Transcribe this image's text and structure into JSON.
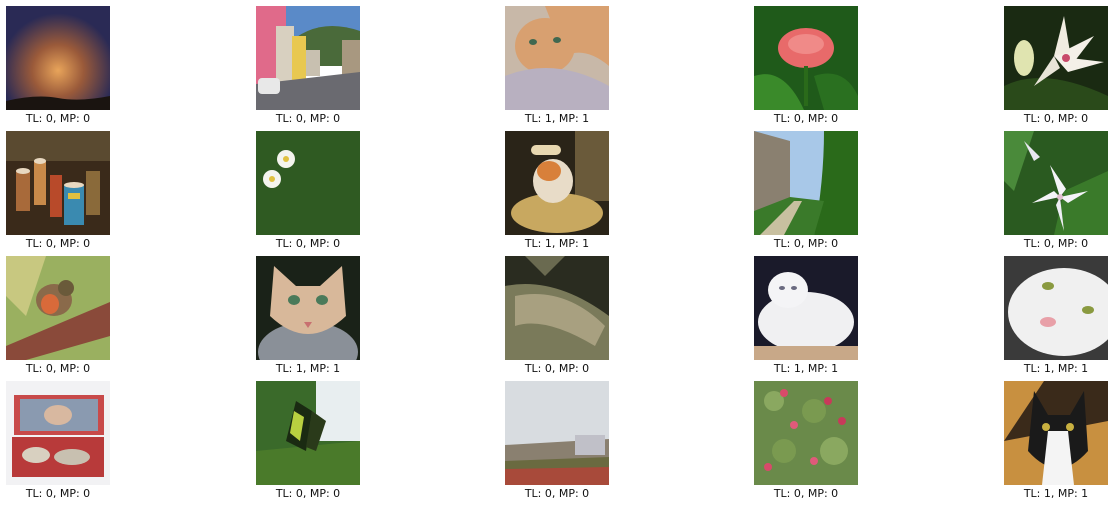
{
  "grid": [
    [
      {
        "caption": "TL: 0, MP: 0",
        "subject": "sunset-sky"
      },
      {
        "caption": "TL: 0, MP: 0",
        "subject": "street-houses"
      },
      {
        "caption": "TL: 1, MP: 1",
        "subject": "orange-cat"
      },
      {
        "caption": "TL: 0, MP: 0",
        "subject": "pink-rose"
      },
      {
        "caption": "TL: 0, MP: 0",
        "subject": "white-lily"
      }
    ],
    [
      {
        "caption": "TL: 0, MP: 0",
        "subject": "drums"
      },
      {
        "caption": "TL: 0, MP: 0",
        "subject": "daisies-on-grass"
      },
      {
        "caption": "TL: 1, MP: 1",
        "subject": "cat-on-cushion"
      },
      {
        "caption": "TL: 0, MP: 0",
        "subject": "garden-path"
      },
      {
        "caption": "TL: 0, MP: 0",
        "subject": "white-star-flowers"
      }
    ],
    [
      {
        "caption": "TL: 0, MP: 0",
        "subject": "robin"
      },
      {
        "caption": "TL: 1, MP: 1",
        "subject": "cat-face"
      },
      {
        "caption": "TL: 0, MP: 0",
        "subject": "dark-leaf"
      },
      {
        "caption": "TL: 1, MP: 1",
        "subject": "white-fluffy-cat"
      },
      {
        "caption": "TL: 1, MP: 1",
        "subject": "white-cat-closeup"
      }
    ],
    [
      {
        "caption": "TL: 0, MP: 0",
        "subject": "photo-box"
      },
      {
        "caption": "TL: 0, MP: 0",
        "subject": "butterfly"
      },
      {
        "caption": "TL: 0, MP: 0",
        "subject": "cloudy-town"
      },
      {
        "caption": "TL: 0, MP: 0",
        "subject": "pink-flower-bush"
      },
      {
        "caption": "TL: 1, MP: 1",
        "subject": "black-white-cat"
      }
    ]
  ]
}
